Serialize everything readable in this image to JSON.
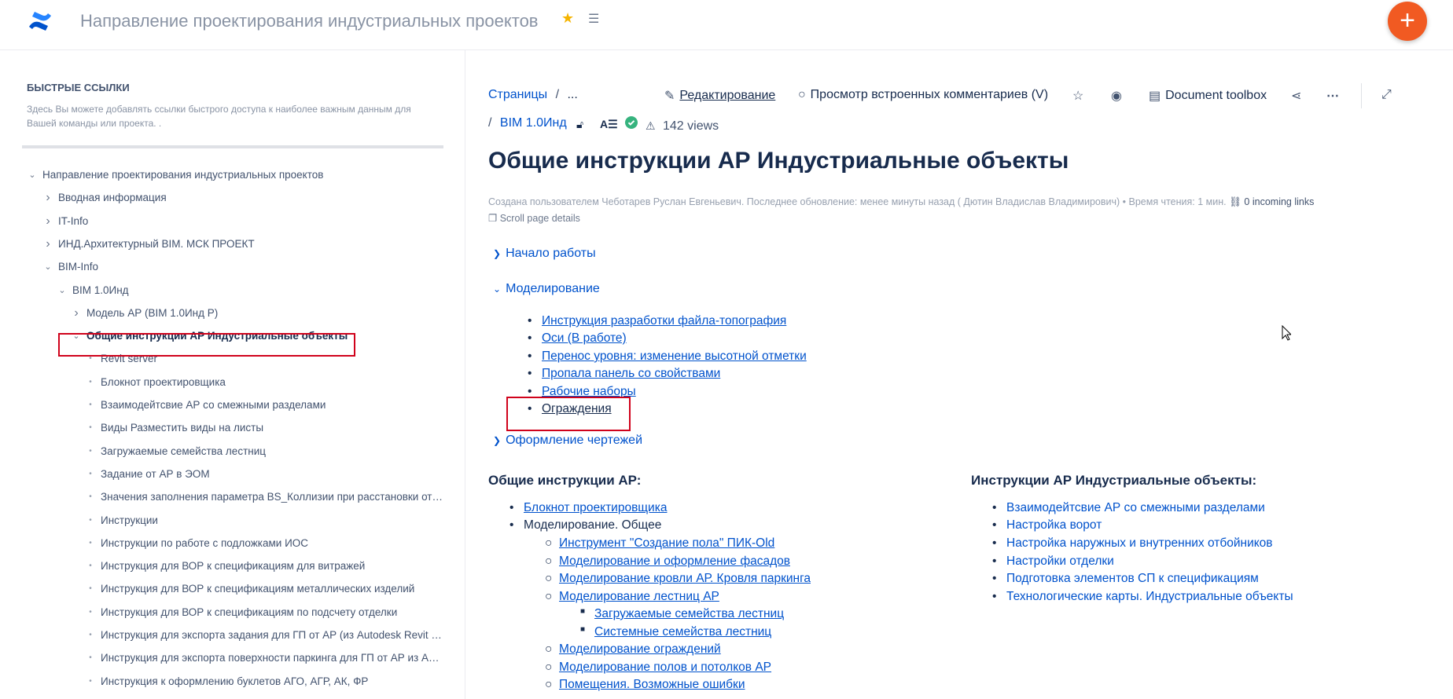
{
  "header": {
    "space_title": "Направление проектирования индустриальных проектов",
    "accent": "#f15a22",
    "fab_label": "+"
  },
  "sidebar": {
    "quick_links_title": "БЫСТРЫЕ ССЫЛКИ",
    "quick_links_desc": "Здесь Вы можете добавлять ссылки быстрого доступа к наиболее важным данным для Вашей команды или проекта. .",
    "tree": [
      {
        "label": "Направление проектирования индустриальных проектов",
        "level": 0,
        "kind": "expanded"
      },
      {
        "label": "Вводная информация",
        "level": 1,
        "kind": "collapsed"
      },
      {
        "label": "IT-Info",
        "level": 1,
        "kind": "collapsed"
      },
      {
        "label": "ИНД.Архитектурный BIM. МСК ПРОЕКТ",
        "level": 1,
        "kind": "collapsed"
      },
      {
        "label": "BIM-Info",
        "level": 1,
        "kind": "expanded"
      },
      {
        "label": "BIM 1.0Инд",
        "level": 2,
        "kind": "expanded"
      },
      {
        "label": "Модель АР (BIM 1.0Инд Р)",
        "level": 3,
        "kind": "collapsed"
      },
      {
        "label": "Общие инструкции АР Индустриальные объекты",
        "level": 3,
        "kind": "expanded",
        "active": true
      },
      {
        "label": "Revit server",
        "level": 4,
        "kind": "leaf"
      },
      {
        "label": "Блокнот проектировщика",
        "level": 4,
        "kind": "leaf"
      },
      {
        "label": "Взаимодейтсвие АР со смежными разделами",
        "level": 4,
        "kind": "leaf"
      },
      {
        "label": "Виды Разместить виды на листы",
        "level": 4,
        "kind": "leaf"
      },
      {
        "label": "Загружаемые семейства лестниц",
        "level": 4,
        "kind": "leaf"
      },
      {
        "label": "Задание от АР в ЭОМ",
        "level": 4,
        "kind": "leaf"
      },
      {
        "label": "Значения заполнения параметра BS_Коллизии при расстановки отве...",
        "level": 4,
        "kind": "leaf"
      },
      {
        "label": "Инструкции",
        "level": 4,
        "kind": "leaf"
      },
      {
        "label": "Инструкции по работе с подложками ИОС",
        "level": 4,
        "kind": "leaf"
      },
      {
        "label": "Инструкция для ВОР к спецификациям для витражей",
        "level": 4,
        "kind": "leaf"
      },
      {
        "label": "Инструкция для ВОР к спецификациям металлических изделий",
        "level": 4,
        "kind": "leaf"
      },
      {
        "label": "Инструкция для ВОР к спецификациям по подсчету отделки",
        "level": 4,
        "kind": "leaf"
      },
      {
        "label": "Инструкция для экспорта задания для ГП от АР (из Autodesk Revit в Ci...",
        "level": 4,
        "kind": "leaf"
      },
      {
        "label": "Инструкция для экспорта поверхности паркинга для ГП от АР из Auto...",
        "level": 4,
        "kind": "leaf"
      },
      {
        "label": "Инструкция к оформлению буклетов АГО, АГР, АК, ФР",
        "level": 4,
        "kind": "leaf"
      }
    ]
  },
  "main": {
    "breadcrumb": {
      "pages": "Страницы",
      "sep": "/",
      "more": "...",
      "sep2": "/",
      "parent": "BIM 1.0Инд"
    },
    "toolbar": {
      "edit": "Редактирование",
      "comments": "Просмотр встроенных комментариев (V)",
      "toolbox": "Document toolbox"
    },
    "views": "142 views",
    "title": "Общие инструкции АР Индустриальные объекты",
    "byline": "Создана пользователем Чеботарев Руслан Евгеньевич. Последнее обновление: менее минуты назад ( Дютин Владислав Владимирович) • Время чтения: 1 мин.",
    "incoming_links": "0 incoming links",
    "scroll_details": "Scroll page details",
    "expanders": {
      "start": "Начало работы",
      "modeling": "Моделирование",
      "drawings": "Оформление чертежей"
    },
    "modeling_links": [
      "Инструкция разработки файла-топография",
      "Оси (В работе)",
      "Перенос уровня: изменение высотной отметки",
      "Пропала панель со свойствами",
      "Рабочие наборы",
      "Ограждения"
    ],
    "general": {
      "heading": "Общие инструкции АР:",
      "notebook": "Блокнот проектировщика",
      "modeling_general": "Моделирование. Общее",
      "sub": [
        "Инструмент \"Создание пола\" ПИК-Old",
        "Моделирование и оформление фасадов",
        "Моделирование кровли АР. Кровля паркинга",
        "Моделирование лестниц АР"
      ],
      "stairs_sub": [
        "Загружаемые семейства лестниц",
        "Системные семейства лестниц"
      ],
      "more": [
        "Моделирование ограждений",
        "Моделирование полов и потолков АР",
        "Помещения. Возможные ошибки"
      ]
    },
    "industrial": {
      "heading": "Инструкции АР Индустриальные объекты:",
      "items": [
        "Взаимодейтсвие АР со смежными разделами",
        "Настройка ворот",
        "Настройка наружных и внутренних отбойников",
        "Настройки отделки",
        "Подготовка элементов СП к спецификациям",
        "Технологические карты. Индустриальные объекты"
      ]
    }
  }
}
